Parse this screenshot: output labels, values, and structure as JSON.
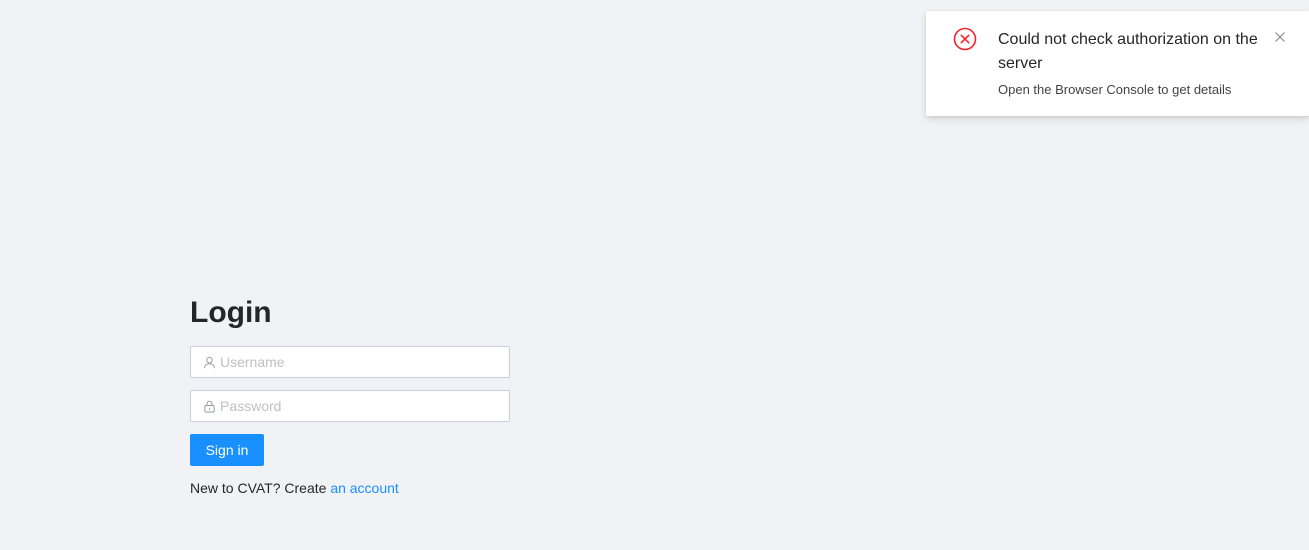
{
  "login": {
    "title": "Login",
    "username": {
      "placeholder": "Username",
      "value": "",
      "icon": "user-icon"
    },
    "password": {
      "placeholder": "Password",
      "value": "",
      "icon": "lock-icon"
    },
    "signin_label": "Sign in",
    "register_prefix": "New to CVAT? Create ",
    "register_link": "an account"
  },
  "notification": {
    "icon": "close-circle-icon",
    "title": "Could not check authorization on the server",
    "description": "Open the Browser Console to get details",
    "close_icon": "close-icon"
  },
  "colors": {
    "background": "#f0f2f5",
    "primary": "#1890ff",
    "error": "#f5222d",
    "text": "#262626",
    "placeholder": "#bfbfbf"
  }
}
